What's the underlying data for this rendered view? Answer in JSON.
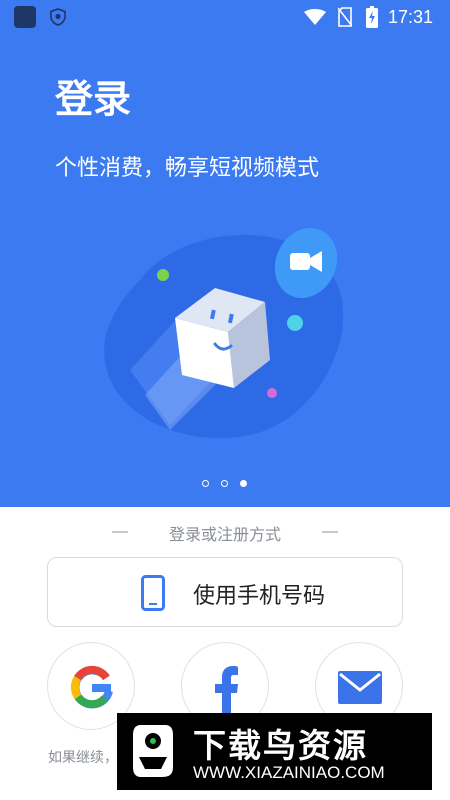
{
  "status_bar": {
    "time": "17:31",
    "icons": [
      "app-icon",
      "shield-icon",
      "wifi-icon",
      "no-sim-icon",
      "battery-charging-icon"
    ]
  },
  "hero": {
    "title": "登录",
    "subtitle": "个性消费，畅享短视频模式",
    "background_color": "#3b7af0",
    "pagination": {
      "count": 3,
      "active": 3
    }
  },
  "login": {
    "divider_label": "登录或注册方式",
    "phone_button_label": "使用手机号码",
    "social_buttons": [
      "google-icon",
      "facebook-icon",
      "email-icon"
    ],
    "terms_prefix": "如果继续，"
  },
  "watermark": {
    "title": "下载鸟资源",
    "url": "WWW.XIAZAINIAO.COM"
  }
}
